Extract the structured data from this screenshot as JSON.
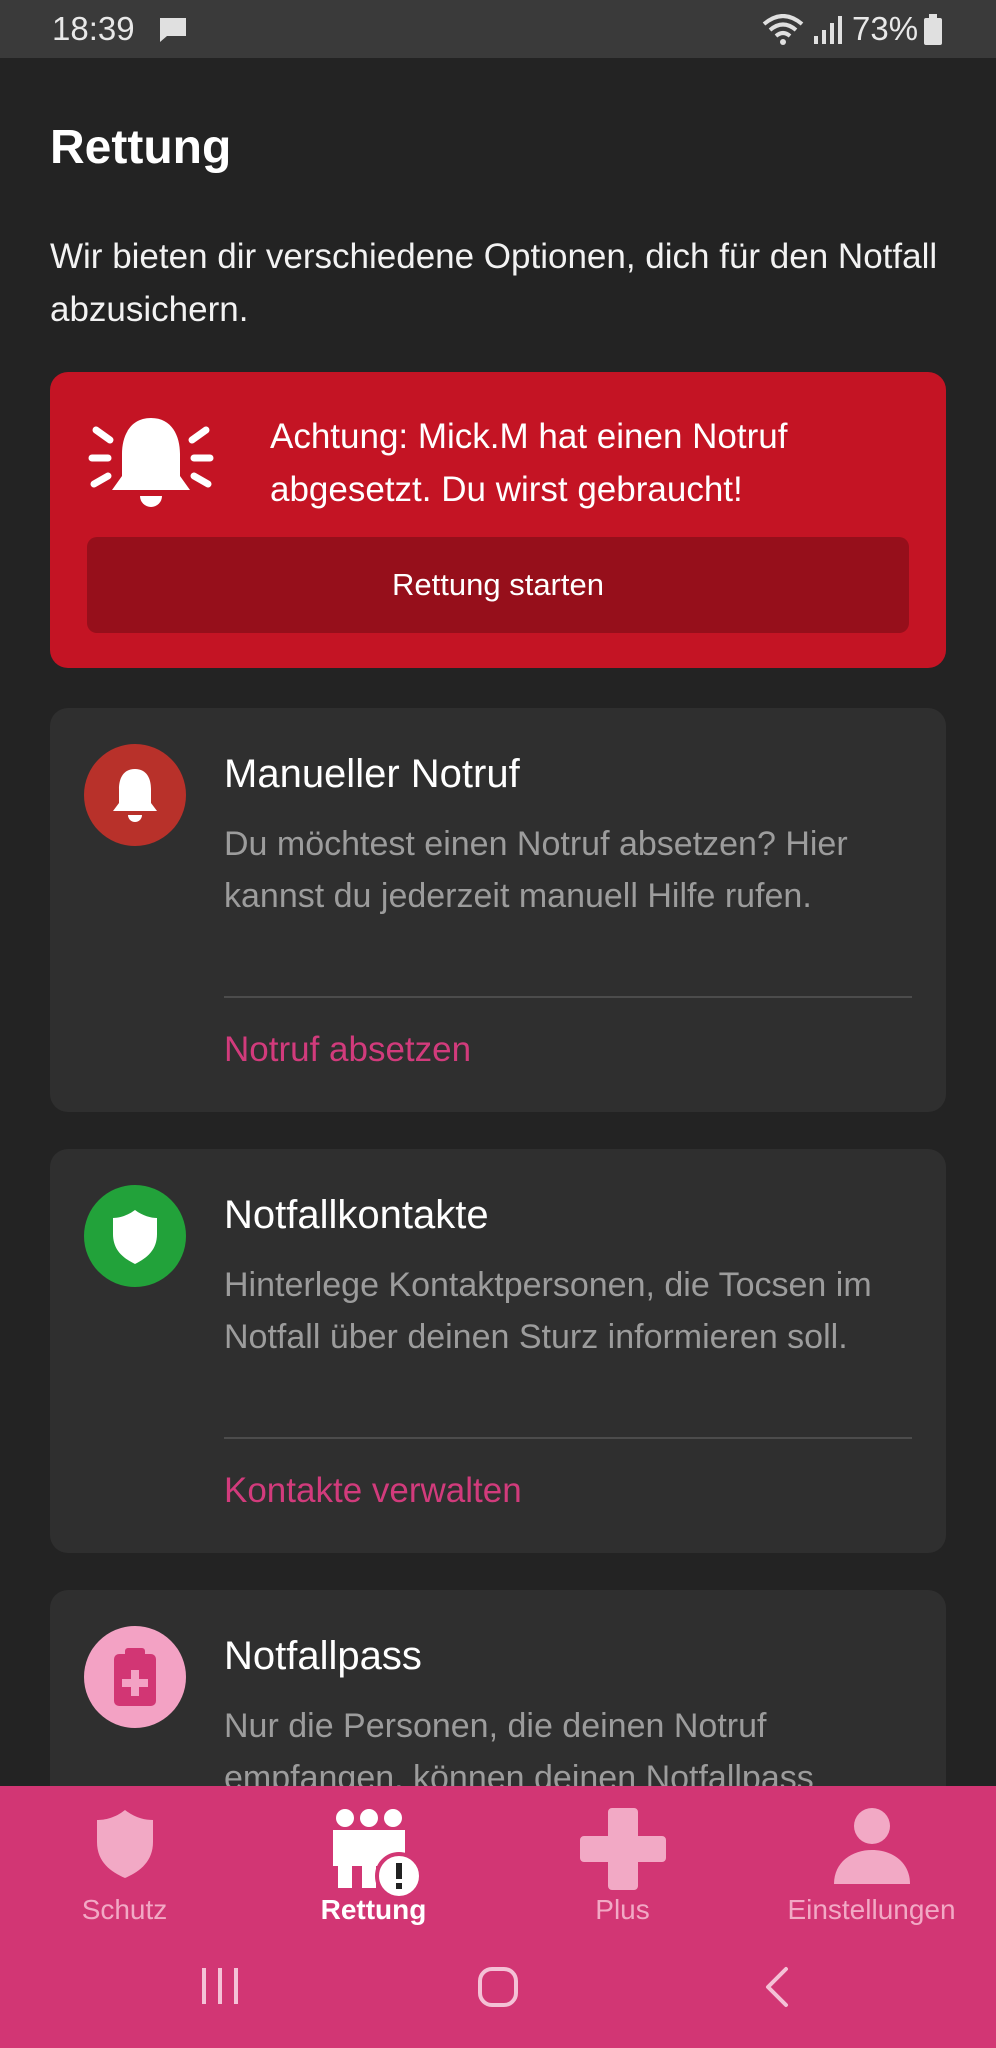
{
  "status_bar": {
    "time": "18:39",
    "battery": "73%",
    "icons": [
      "message-icon",
      "wifi-icon",
      "signal-icon",
      "battery-icon"
    ]
  },
  "page": {
    "title": "Rettung",
    "intro": "Wir bieten dir verschiedene Optionen, dich für den Notfall abzusichern."
  },
  "alert": {
    "text": "Achtung: Mick.M hat einen Notruf abgesetzt. Du wirst gebraucht!",
    "button": "Rettung starten",
    "color": "#c41424"
  },
  "cards": [
    {
      "title": "Manueller Notruf",
      "description": "Du möchtest einen Notruf absetzen? Hier kannst du jederzeit manuell Hilfe rufen.",
      "link": "Notruf absetzen",
      "icon": "bell-icon",
      "icon_color": "#b8312a"
    },
    {
      "title": "Notfallkontakte",
      "description": "Hinterlege Kontaktpersonen, die Tocsen im Notfall über deinen Sturz informieren soll.",
      "link": "Kontakte verwalten",
      "icon": "shield-icon",
      "icon_color": "#22a23a"
    },
    {
      "title": "Notfallpass",
      "description": "Nur die Personen, die deinen Notruf empfangen, können deinen Notfallpass",
      "icon": "medical-clipboard-icon",
      "icon_color": "#f3a2c4"
    }
  ],
  "bottom_nav": {
    "items": [
      {
        "label": "Schutz",
        "icon": "shield-icon"
      },
      {
        "label": "Rettung",
        "icon": "people-alert-icon",
        "active": true
      },
      {
        "label": "Plus",
        "icon": "plus-icon"
      },
      {
        "label": "Einstellungen",
        "icon": "person-icon"
      }
    ],
    "color": "#d23674"
  },
  "system_nav": [
    "recents-button",
    "home-button",
    "back-button"
  ]
}
